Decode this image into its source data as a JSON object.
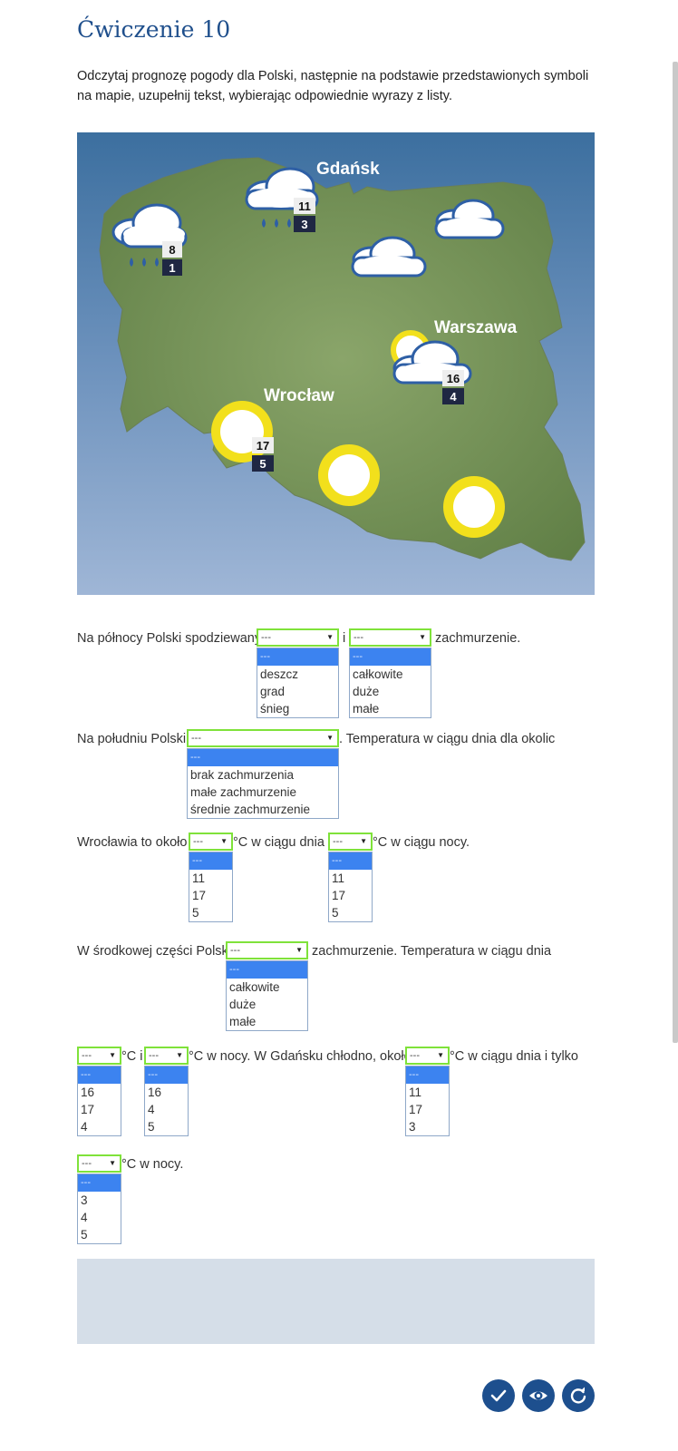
{
  "title": "Ćwiczenie 10",
  "instruction": "Odczytaj prognozę pogody dla Polski, następnie na podstawie przedstawionych symboli na mapie, uzupełnij tekst, wybierając odpowiednie wyrazy z listy.",
  "map": {
    "cities": {
      "gdansk": "Gdańsk",
      "warszawa": "Warszawa",
      "wroclaw": "Wrocław"
    },
    "temps": {
      "west": {
        "day": "8",
        "night": "1"
      },
      "gdansk": {
        "day": "11",
        "night": "3"
      },
      "warszawa": {
        "day": "16",
        "night": "4"
      },
      "wroclaw": {
        "day": "17",
        "night": "5"
      }
    }
  },
  "text": {
    "s1a": "Na północy Polski spodziewany",
    "s1b": "i",
    "s1c": "zachmurzenie.",
    "s2a": "Na południu Polski",
    "s2b": ". Temperatura w ciągu dnia dla okolic",
    "s3a": "Wrocławia to około",
    "s3b": "°C w ciągu dnia i",
    "s3c": "°C w ciągu nocy.",
    "s4a": "W środkowej części Polski",
    "s4b": "zachmurzenie. Temperatura w ciągu dnia",
    "s5a": "°C i",
    "s5b": "°C w nocy. W Gdańsku chłodno, około",
    "s5c": "°C  w ciągu dnia i tylko",
    "s6a": "°C w nocy."
  },
  "selects": {
    "s1": {
      "value": "---",
      "options": [
        "---",
        "deszcz",
        "grad",
        "śnieg"
      ]
    },
    "s2": {
      "value": "---",
      "options": [
        "---",
        "całkowite",
        "duże",
        "małe"
      ]
    },
    "s3": {
      "value": "---",
      "options": [
        "---",
        "brak zachmurzenia",
        "małe zachmurzenie",
        "średnie zachmurzenie"
      ]
    },
    "s4": {
      "value": "---",
      "options": [
        "---",
        "11",
        "17",
        "5"
      ]
    },
    "s5": {
      "value": "---",
      "options": [
        "---",
        "11",
        "17",
        "5"
      ]
    },
    "s6": {
      "value": "---",
      "options": [
        "---",
        "całkowite",
        "duże",
        "małe"
      ]
    },
    "s7": {
      "value": "---",
      "options": [
        "---",
        "16",
        "17",
        "4"
      ]
    },
    "s8": {
      "value": "---",
      "options": [
        "---",
        "16",
        "4",
        "5"
      ]
    },
    "s9": {
      "value": "---",
      "options": [
        "---",
        "11",
        "17",
        "3"
      ]
    },
    "s10": {
      "value": "---",
      "options": [
        "---",
        "3",
        "4",
        "5"
      ]
    }
  },
  "buttons": {
    "check": "check-icon",
    "show": "eye-icon",
    "reset": "refresh-icon"
  }
}
